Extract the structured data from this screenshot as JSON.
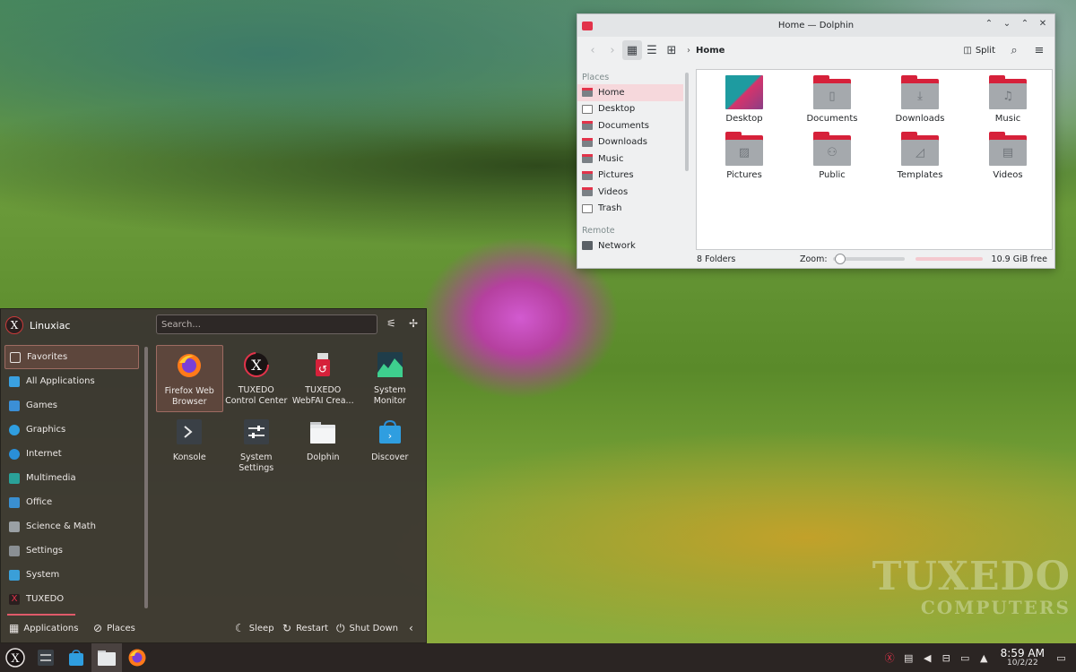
{
  "dolphin": {
    "title": "Home — Dolphin",
    "breadcrumb": "Home",
    "split_label": "Split",
    "places_header": "Places",
    "remote_header": "Remote",
    "places": [
      "Home",
      "Desktop",
      "Documents",
      "Downloads",
      "Music",
      "Pictures",
      "Videos",
      "Trash"
    ],
    "remote": [
      "Network"
    ],
    "folders": [
      "Desktop",
      "Documents",
      "Downloads",
      "Music",
      "Pictures",
      "Public",
      "Templates",
      "Videos"
    ],
    "status_count": "8 Folders",
    "zoom_label": "Zoom:",
    "free_space": "10.9 GiB free"
  },
  "launcher": {
    "user_name": "Linuxiac",
    "search_placeholder": "Search...",
    "categories": [
      "Favorites",
      "All Applications",
      "Games",
      "Graphics",
      "Internet",
      "Multimedia",
      "Office",
      "Science & Math",
      "Settings",
      "System",
      "TUXEDO"
    ],
    "apps": [
      {
        "line1": "Firefox Web",
        "line2": "Browser"
      },
      {
        "line1": "TUXEDO",
        "line2": "Control Center"
      },
      {
        "line1": "TUXEDO",
        "line2": "WebFAI Crea..."
      },
      {
        "line1": "System",
        "line2": "Monitor"
      },
      {
        "line1": "Konsole",
        "line2": ""
      },
      {
        "line1": "System",
        "line2": "Settings"
      },
      {
        "line1": "Dolphin",
        "line2": ""
      },
      {
        "line1": "Discover",
        "line2": ""
      }
    ],
    "footer": {
      "applications": "Applications",
      "places": "Places",
      "sleep": "Sleep",
      "restart": "Restart",
      "shutdown": "Shut Down"
    }
  },
  "taskbar": {
    "time": "8:59 AM",
    "date": "10/2/22"
  },
  "watermark": {
    "line1": "TUXEDO",
    "line2": "COMPUTERS"
  },
  "colors": {
    "accent": "#e2334a",
    "launcher_bg": "#3a3432",
    "taskbar_bg": "#2b2523"
  }
}
